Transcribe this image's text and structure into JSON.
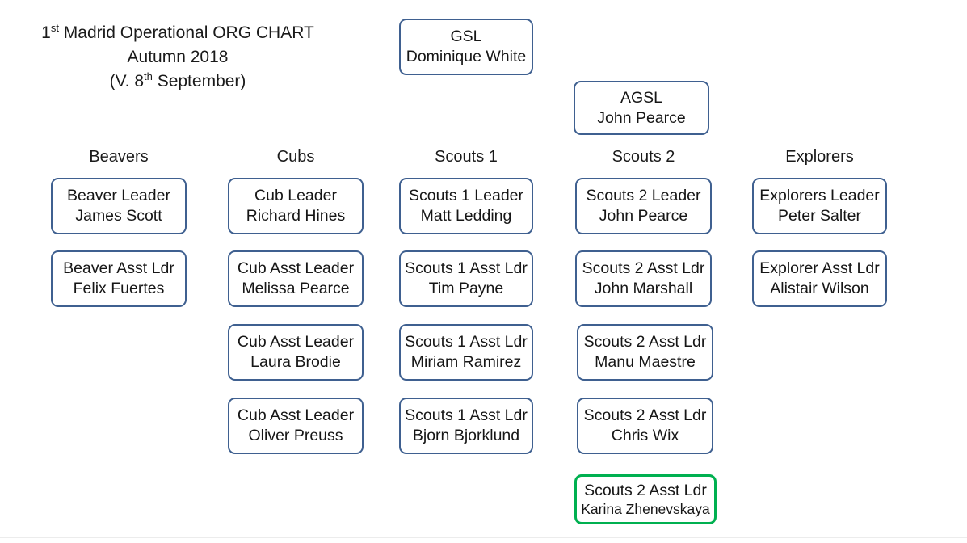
{
  "title": {
    "line1_prefix": "1",
    "line1_sup": "st",
    "line1_rest": " Madrid Operational ORG CHART",
    "line2": "Autumn 2018",
    "line3_prefix": "(V. 8",
    "line3_sup": "th",
    "line3_rest": " September)"
  },
  "colors": {
    "box_border_blue": "#3f6090",
    "box_border_green": "#00b050",
    "text": "#161616",
    "background": "#ffffff"
  },
  "top_nodes": [
    {
      "role": "GSL",
      "person": "Dominique White"
    },
    {
      "role": "AGSL",
      "person": "John Pearce"
    }
  ],
  "columns": [
    {
      "header": "Beavers",
      "nodes": [
        {
          "role": "Beaver Leader",
          "person": "James Scott",
          "highlight": false
        },
        {
          "role": "Beaver Asst Ldr",
          "person": "Felix Fuertes",
          "highlight": false
        }
      ]
    },
    {
      "header": "Cubs",
      "nodes": [
        {
          "role": "Cub Leader",
          "person": "Richard Hines",
          "highlight": false
        },
        {
          "role": "Cub Asst Leader",
          "person": "Melissa Pearce",
          "highlight": false
        },
        {
          "role": "Cub Asst Leader",
          "person": "Laura Brodie",
          "highlight": false
        },
        {
          "role": "Cub Asst Leader",
          "person": "Oliver Preuss",
          "highlight": false
        }
      ]
    },
    {
      "header": "Scouts 1",
      "nodes": [
        {
          "role": "Scouts 1 Leader",
          "person": "Matt Ledding",
          "highlight": false
        },
        {
          "role": "Scouts 1 Asst Ldr",
          "person": "Tim Payne",
          "highlight": false
        },
        {
          "role": "Scouts 1 Asst Ldr",
          "person": "Miriam Ramirez",
          "highlight": false
        },
        {
          "role": "Scouts 1 Asst Ldr",
          "person": "Bjorn Bjorklund",
          "highlight": false
        }
      ]
    },
    {
      "header": "Scouts 2",
      "nodes": [
        {
          "role": "Scouts 2 Leader",
          "person": "John Pearce",
          "highlight": false
        },
        {
          "role": "Scouts 2 Asst Ldr",
          "person": "John Marshall",
          "highlight": false
        },
        {
          "role": "Scouts 2 Asst Ldr",
          "person": "Manu Maestre",
          "highlight": false
        },
        {
          "role": "Scouts 2 Asst Ldr",
          "person": "Chris Wix",
          "highlight": false
        },
        {
          "role": "Scouts 2 Asst Ldr",
          "person": "Karina Zhenevskaya",
          "highlight": true
        }
      ]
    },
    {
      "header": "Explorers",
      "nodes": [
        {
          "role": "Explorers Leader",
          "person": "Peter Salter",
          "highlight": false
        },
        {
          "role": "Explorer Asst Ldr",
          "person": "Alistair Wilson",
          "highlight": false
        }
      ]
    }
  ]
}
